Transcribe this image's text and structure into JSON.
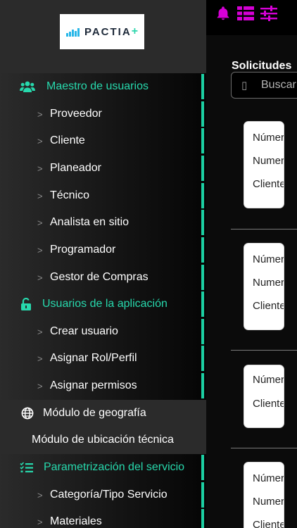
{
  "app": {
    "logo_text": "PACTIA",
    "logo_plus": "+"
  },
  "topbar": {
    "icons": [
      "bell-icon",
      "table-icon",
      "sliders-icon"
    ],
    "accent_color": "#d600d6"
  },
  "main": {
    "title": "Solicitudes",
    "search": {
      "icon": "search-icon",
      "placeholder": "Buscar"
    },
    "cards": [
      {
        "lines": [
          "Número",
          "Numer",
          "Cliente"
        ]
      },
      {
        "lines": [
          "Número",
          "Numer",
          "Cliente"
        ]
      },
      {
        "lines": [
          "Número",
          "Cliente"
        ]
      },
      {
        "lines": [
          "Número",
          "Numer",
          "Cliente"
        ]
      }
    ]
  },
  "drawer": {
    "items": [
      {
        "label": "Maestro de usuarios",
        "type": "section",
        "icon": "users-icon"
      },
      {
        "label": "Proveedor",
        "type": "sub",
        "chevron": ">"
      },
      {
        "label": "Cliente",
        "type": "sub",
        "chevron": ">"
      },
      {
        "label": "Planeador",
        "type": "sub",
        "chevron": ">"
      },
      {
        "label": "Técnico",
        "type": "sub",
        "chevron": ">"
      },
      {
        "label": "Analista en sitio",
        "type": "sub",
        "chevron": ">"
      },
      {
        "label": "Programador",
        "type": "sub",
        "chevron": ">"
      },
      {
        "label": "Gestor de Compras",
        "type": "sub",
        "chevron": ">"
      },
      {
        "label": "Usuarios de la aplicación",
        "type": "section",
        "icon": "unlock-icon"
      },
      {
        "label": "Crear usuario",
        "type": "sub",
        "chevron": ">"
      },
      {
        "label": "Asignar Rol/Perfil",
        "type": "sub",
        "chevron": ">"
      },
      {
        "label": "Asignar permisos",
        "type": "sub",
        "chevron": ">"
      },
      {
        "label": "Módulo de geografía",
        "type": "plain-icon",
        "icon": "globe-icon"
      },
      {
        "label": "Módulo de ubicación técnica",
        "type": "plain"
      },
      {
        "label": "Parametrización del servicio",
        "type": "section",
        "icon": "checklist-icon"
      },
      {
        "label": "Categoría/Tipo Servicio",
        "type": "sub",
        "chevron": ">"
      },
      {
        "label": "Materiales",
        "type": "sub",
        "chevron": ">"
      }
    ],
    "colors": {
      "accent": "#1ccfa3",
      "panel": "#2b2b2b",
      "text": "#ffffff"
    }
  }
}
